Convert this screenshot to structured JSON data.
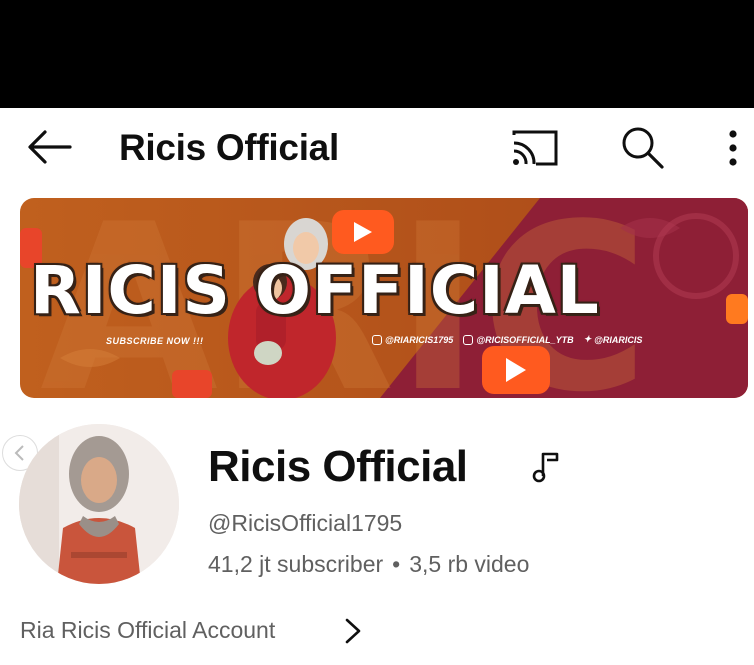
{
  "header": {
    "title": "Ricis Official",
    "icons": [
      "back-arrow-icon",
      "cast-icon",
      "search-icon",
      "more-vert-icon"
    ]
  },
  "banner": {
    "title": "RICIS OFFICIAL",
    "subscribe_text": "SUBSCRIBE NOW !!!",
    "handles": [
      "@RIARICIS1795",
      "@RICISOFFICIAL_YTB",
      "@RIARICIS"
    ],
    "colors": {
      "left": "#b85a1f",
      "right": "#8e1f36",
      "accent": "#ff5a1f"
    }
  },
  "channel": {
    "name": "Ricis Official",
    "handle": "@RicisOfficial1795",
    "subscribers": "41,2 jt subscriber",
    "separator": "•",
    "videos": "3,5 rb video",
    "description": "Ria Ricis Official Account"
  },
  "colors": {
    "text_primary": "#0f0f0f",
    "text_secondary": "#606060"
  }
}
